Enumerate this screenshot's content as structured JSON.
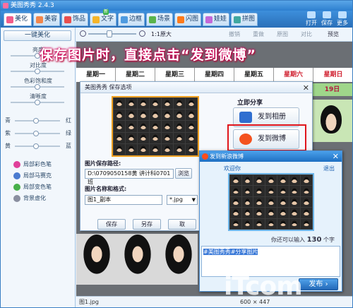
{
  "app": {
    "title": "美图秀秀 2.4.3"
  },
  "tabs": [
    {
      "label": "美化",
      "color": "#f25c8a"
    },
    {
      "label": "美容",
      "color": "#f2864b"
    },
    {
      "label": "饰品",
      "color": "#e84e4e"
    },
    {
      "label": "文字",
      "color": "#f5b52a"
    },
    {
      "label": "边框",
      "color": "#4f9be0"
    },
    {
      "label": "场景",
      "color": "#5ab44c"
    },
    {
      "label": "闪图",
      "color": "#ff7a1a"
    },
    {
      "label": "娃娃",
      "color": "#c468d8"
    },
    {
      "label": "拼图",
      "color": "#3fa7a0"
    }
  ],
  "tab_badge": "新",
  "window_buttons": {
    "open": "打开",
    "save": "保存",
    "more": "更多"
  },
  "toolbar": {
    "zoom_label": "1:1原大",
    "undo": "撤销",
    "redo": "重做",
    "restore": "原图",
    "compare": "对比",
    "preview": "预览"
  },
  "sidebar": {
    "one_click": "一键美化",
    "sliders": [
      {
        "label": "亮度",
        "level": 0.5
      },
      {
        "label": "对比度",
        "level": 0.5
      },
      {
        "label": "色彩饱和度",
        "level": 0.5
      },
      {
        "label": "清晰度",
        "level": 0.5
      }
    ],
    "color_sliders": [
      {
        "left": "青",
        "right": "红"
      },
      {
        "left": "紫",
        "right": "绿"
      },
      {
        "left": "黄",
        "right": "蓝"
      }
    ],
    "brushes": [
      {
        "label": "局部彩色笔",
        "color": "#e0409a"
      },
      {
        "label": "局部马赛克",
        "color": "#4a7bd0"
      },
      {
        "label": "局部变色笔",
        "color": "#47b04a"
      },
      {
        "label": "背景虚化",
        "color": "#8a8fa0"
      }
    ]
  },
  "banner": "保存图片时，直接点击“发到微博”",
  "calendar": {
    "days": [
      "星期一",
      "星期二",
      "星期三",
      "星期四",
      "星期五",
      "星期六",
      "星期日"
    ],
    "date": "19日"
  },
  "save_dialog": {
    "title": "美图秀秀 保存选项",
    "share_title": "立即分享",
    "share_album": "发到相册",
    "share_weibo": "发到微博",
    "path_label": "图片保存路径:",
    "path_value": "D:\\0709050158黄 讲计科0701班",
    "browse": "浏览",
    "name_label": "图片名称和格式:",
    "name_value": "图1_副本",
    "format": "*.jpg",
    "save": "保存",
    "save_as": "另存",
    "cancel": "取"
  },
  "weibo_dialog": {
    "title": "发到新浪微博",
    "welcome": "欢迎你",
    "logout": "退出",
    "remaining_prefix": "你还可以输入",
    "remaining_count": "130",
    "remaining_suffix": "个字",
    "message": "#美图秀秀#分享图片",
    "publish": "发布"
  },
  "status": {
    "filename": "图1.jpg",
    "size": "600 × 447"
  },
  "watermark": "iTcom"
}
